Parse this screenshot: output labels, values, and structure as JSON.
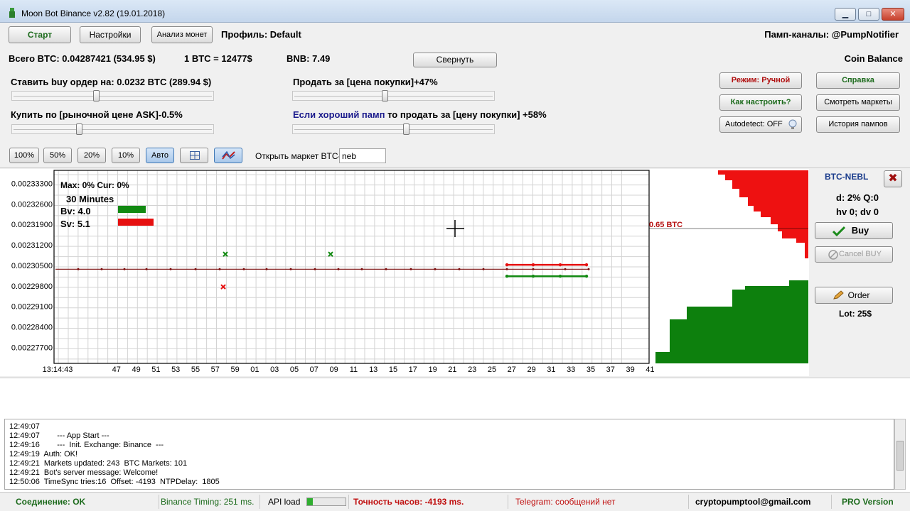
{
  "window": {
    "title": "Moon Bot Binance v2.82 (19.01.2018)",
    "min_glyph": "▁",
    "max_glyph": "□",
    "close_glyph": "✕"
  },
  "toolbar": {
    "start_label": "Старт",
    "settings_label": "Настройки",
    "analyze_label": "Анализ монет",
    "profile_label": "Профиль: Default",
    "pump_channels": "Памп-каналы:  @PumpNotifier"
  },
  "balance": {
    "total_btc": "Всего BTC: 0.04287421 (534.95 $)",
    "btc_price": "1 BTC = 12477$",
    "bnb": "BNB: 7.49",
    "collapse_label": "Свернуть",
    "coin_balance": "Coin Balance"
  },
  "settings_panel": {
    "buy_order_text": "Ставить buy ордер на: 0.0232 BTC  (289.94 $)",
    "sell_text": "Продать за [цена покупки]+47%",
    "buy_market_text": "Купить по [рыночной цене ASK]-0.5%",
    "good_pump_highlight": "Если хороший памп",
    "good_pump_rest": " то продать за [цену покупки] +58%",
    "slider_buy": 0.42,
    "slider_sell": 0.46,
    "slider_market": 0.33,
    "slider_pump": 0.57
  },
  "side_buttons": {
    "mode": "Режим: Ручной",
    "help": "Справка",
    "how_to": "Как настроить?",
    "view_markets": "Смотреть маркеты",
    "autodetect": "Autodetect: OFF",
    "pump_history": "История пампов"
  },
  "chart_toolbar": {
    "btn_100": "100%",
    "btn_50": "50%",
    "btn_20": "20%",
    "btn_10": "10%",
    "btn_auto": "Авто",
    "open_market_label": "Открыть маркет BTC-",
    "market_input_value": "neb"
  },
  "chart_info": {
    "max_cur": "Max: 0%   Cur: 0%",
    "interval": "30 Minutes",
    "bv": "Bv: 4.0",
    "sv": "Sv: 5.1",
    "depth_label": "0.65 BTC",
    "bv_color": "#128a12",
    "sv_color": "#e61010"
  },
  "chart_data": {
    "type": "line",
    "y_ticks": [
      "0.00233300",
      "0.00232600",
      "0.00231900",
      "0.00231200",
      "0.00230500",
      "0.00229800",
      "0.00229100",
      "0.00228400",
      "0.00227700"
    ],
    "x_ticks": [
      "13:14:43",
      "47",
      "49",
      "51",
      "53",
      "55",
      "57",
      "59",
      "01",
      "03",
      "05",
      "07",
      "09",
      "11",
      "13",
      "15",
      "17",
      "19",
      "21",
      "23",
      "25",
      "27",
      "29",
      "31",
      "33",
      "35",
      "37",
      "39",
      "41"
    ],
    "ylim": [
      0.0022715,
      0.0023375
    ],
    "grid": true,
    "series": [
      {
        "color": "#7a0b0b",
        "x_index": [
          0.95,
          3.6
        ],
        "y": [
          0.0023037,
          0.0023037
        ]
      },
      {
        "color": "#e61010",
        "x_index": [
          23.2,
          27.2
        ],
        "y": [
          0.0023052,
          0.0023052
        ]
      },
      {
        "color": "#128a12",
        "x_index": [
          23.2,
          27.2
        ],
        "y": [
          0.0023013,
          0.0023013
        ]
      }
    ],
    "markers": [
      {
        "x_index": 9.1,
        "y": 0.0023052,
        "color": "#128a12"
      },
      {
        "x_index": 14.4,
        "y": 0.0023052,
        "color": "#128a12"
      },
      {
        "x_index": 9.0,
        "y": 0.0023013,
        "color": "#e61010"
      }
    ]
  },
  "market_panel": {
    "pair": "BTC-NEBL",
    "d_q": "d: 2% Q:0",
    "hv_dv": "hv 0; dv 0",
    "buy_label": "Buy",
    "cancel_buy_label": "Cancel BUY",
    "order_label": "Order",
    "lot_label": "Lot: 25$",
    "close_glyph": "✖"
  },
  "log": {
    "lines": [
      "12:49:07",
      "12:49:07        --- App Start ---",
      "12:49:16        ---  Init. Exchange: Binance  ---",
      "12:49:19  Auth: OK!",
      "12:49:21  Markets updated: 243  BTC Markets: 101",
      "12:49:21  Bot's server message: Welcome!",
      "12:50:06  TimeSync tries:16  Offset: -4193  NTPDelay:  1805"
    ]
  },
  "statusbar": {
    "connection": "Соединение:  OK",
    "timing": "Binance Timing: 251 ms.",
    "api_load": "API load",
    "api_load_value": 0.14,
    "clock": "Точность часов: -4193 ms.",
    "telegram": "Telegram: сообщений нет",
    "email": "cryptopumptool@gmail.com",
    "version": "PRO Version"
  }
}
